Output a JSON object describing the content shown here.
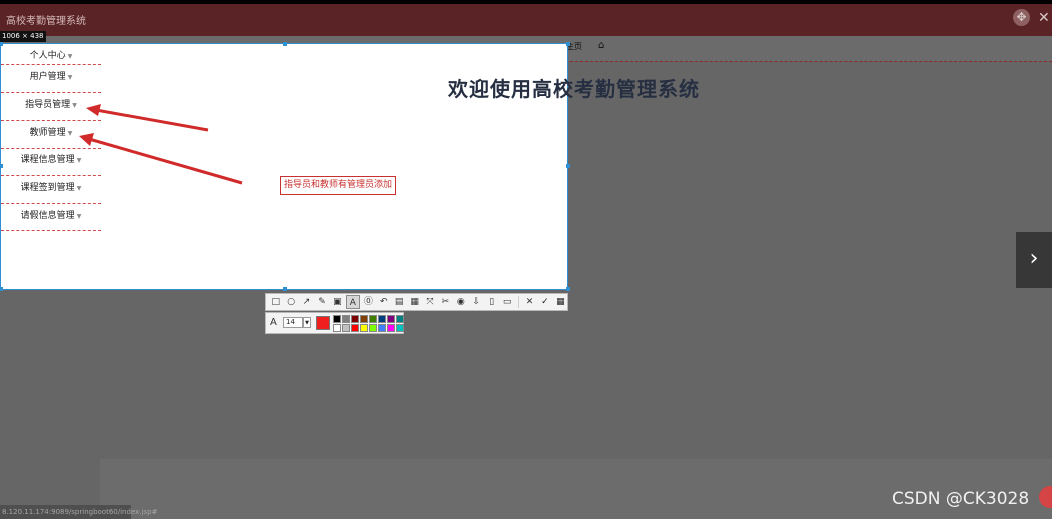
{
  "window": {
    "title": "高校考勤管理系统",
    "icons": [
      "fullscreen-icon",
      "close-icon"
    ]
  },
  "nav": {
    "home_label": "主页",
    "home_icon": "home-icon"
  },
  "capture": {
    "dimensions_label": "1006 × 438"
  },
  "sidebar": {
    "items": [
      {
        "label": "个人中心"
      },
      {
        "label": "用户管理"
      },
      {
        "label": "指导员管理"
      },
      {
        "label": "教师管理"
      },
      {
        "label": "课程信息管理"
      },
      {
        "label": "课程签到管理"
      },
      {
        "label": "请假信息管理"
      }
    ]
  },
  "main": {
    "welcome_title": "欢迎使用高校考勤管理系统",
    "annotation": "指导员和教师有管理员添加"
  },
  "toolbar": {
    "tools": [
      {
        "name": "rectangle-tool-icon",
        "glyph": "□"
      },
      {
        "name": "ellipse-tool-icon",
        "glyph": "○"
      },
      {
        "name": "arrow-tool-icon",
        "glyph": "↗"
      },
      {
        "name": "pen-tool-icon",
        "glyph": "✎"
      },
      {
        "name": "mosaic-tool-icon",
        "glyph": "▣"
      },
      {
        "name": "text-tool-icon",
        "glyph": "A"
      },
      {
        "name": "number-tool-icon",
        "glyph": "⓪"
      },
      {
        "name": "undo-icon",
        "glyph": "↶"
      },
      {
        "name": "ocr-icon",
        "glyph": "▤"
      },
      {
        "name": "translate-icon",
        "glyph": "▦"
      },
      {
        "name": "region-icon",
        "glyph": "⤧"
      },
      {
        "name": "pin-icon",
        "glyph": "✂"
      },
      {
        "name": "record-icon",
        "glyph": "◉"
      },
      {
        "name": "download-icon",
        "glyph": "⇩"
      },
      {
        "name": "copy-icon",
        "glyph": "▯"
      },
      {
        "name": "chat-icon",
        "glyph": "▭"
      },
      {
        "name": "cancel-icon",
        "glyph": "✕"
      },
      {
        "name": "confirm-icon",
        "glyph": "✓"
      },
      {
        "name": "save-icon",
        "glyph": "▦"
      }
    ],
    "active_tool": "text-tool-icon"
  },
  "properties": {
    "font_size": "14",
    "current_color": "#f01f1f",
    "palette": [
      "#000000",
      "#7f7f7f",
      "#7f0000",
      "#7f3f00",
      "#3f7f00",
      "#003f7f",
      "#7f007f",
      "#008080",
      "#ffffff",
      "#c0c0c0",
      "#ff0000",
      "#ffff00",
      "#80ff00",
      "#3f7fff",
      "#ff00ff",
      "#00c0c0"
    ]
  },
  "status": {
    "url": "8.120.11.174:9089/springboot60/index.jsp#"
  },
  "watermark": {
    "text": "CSDN @CK3028"
  },
  "colors": {
    "title_bar": "#5a2426",
    "capture_border": "#2f8fd1",
    "annotation": "#c93131",
    "welcome_text": "#262f42"
  }
}
